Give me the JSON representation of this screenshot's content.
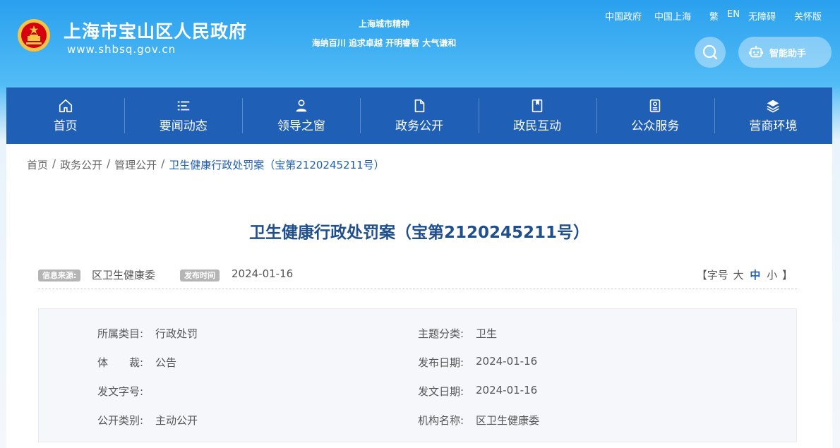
{
  "header": {
    "site_title": "上海市宝山区人民政府",
    "site_url": "www.shbsq.gov.cn",
    "spirit_title": "上海城市精神",
    "spirit_motto": "海纳百川 追求卓越 开明睿智 大气谦和",
    "top_links": [
      "中国政府",
      "中国上海",
      "繁",
      "EN",
      "无障碍",
      "关怀版"
    ],
    "assistant_label": "智能助手"
  },
  "nav": {
    "items": [
      {
        "label": "首页",
        "icon": "home-icon"
      },
      {
        "label": "要闻动态",
        "icon": "list-icon"
      },
      {
        "label": "领导之窗",
        "icon": "person-icon"
      },
      {
        "label": "政务公开",
        "icon": "document-icon"
      },
      {
        "label": "政民互动",
        "icon": "bookmark-icon"
      },
      {
        "label": "公众服务",
        "icon": "service-icon"
      },
      {
        "label": "营商环境",
        "icon": "layers-icon"
      }
    ]
  },
  "breadcrumb": {
    "items": [
      "首页",
      "政务公开",
      "管理公开"
    ],
    "current": "卫生健康行政处罚案（宝第2120245211号）",
    "separator": "/"
  },
  "article": {
    "title": "卫生健康行政处罚案（宝第2120245211号）",
    "source_label": "信息来源:",
    "source_value": "区卫生健康委",
    "date_label": "发布时间",
    "date_value": "2024-01-16",
    "font_size": {
      "prefix": "【字号",
      "large": "大",
      "medium": "中",
      "small": "小",
      "suffix": "】"
    }
  },
  "info": {
    "category_label": "所属类目:",
    "category_value": "行政处罚",
    "topic_label": "主题分类:",
    "topic_value": "卫生",
    "genre_label": "体　　裁:",
    "genre_value": "公告",
    "publish_label": "发布日期:",
    "publish_value": "2024-01-16",
    "docno_label": "发文字号:",
    "docno_value": "",
    "issue_label": "发文日期:",
    "issue_value": "2024-01-16",
    "opentype_label": "公开类别:",
    "opentype_value": "主动公开",
    "org_label": "机构名称:",
    "org_value": "区卫生健康委"
  },
  "colors": {
    "nav_bg": "#1f5fb5",
    "title_color": "#1f4f8c",
    "accent": "#1f5fb5",
    "emblem_red": "#d7000f",
    "emblem_gold": "#f6c343"
  }
}
